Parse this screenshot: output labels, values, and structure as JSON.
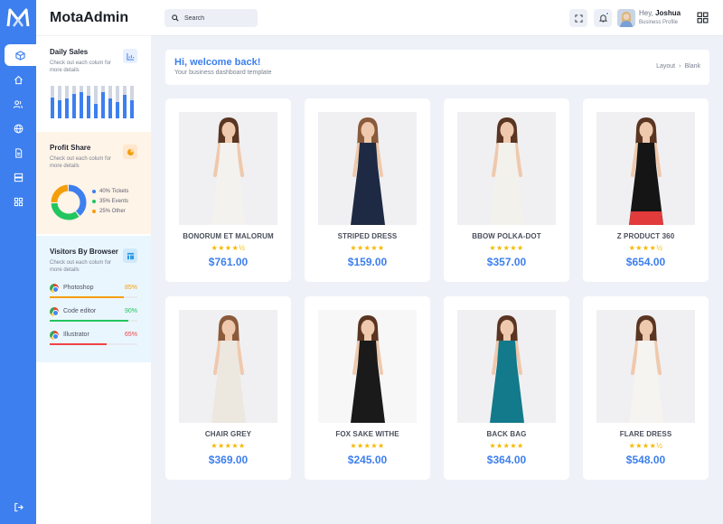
{
  "app": {
    "brand": "MotaAdmin"
  },
  "colors": {
    "accent": "#3d7fee",
    "panel": "#ffffff",
    "background": "#eef1f8",
    "star": "#f5b800"
  },
  "header": {
    "search_placeholder": "Search",
    "greeting_prefix": "Hey,",
    "user_name": "Joshua",
    "user_role": "Business Profile",
    "icons": [
      "search-icon",
      "fullscreen-icon",
      "bell-icon",
      "apps-grid-icon"
    ]
  },
  "sidebar": {
    "items": [
      {
        "icon": "box-icon",
        "active": true
      },
      {
        "icon": "home-icon",
        "active": false
      },
      {
        "icon": "users-icon",
        "active": false
      },
      {
        "icon": "globe-icon",
        "active": false
      },
      {
        "icon": "document-icon",
        "active": false
      },
      {
        "icon": "server-icon",
        "active": false
      },
      {
        "icon": "grid-icon",
        "active": false
      }
    ],
    "logout_icon": "logout-icon"
  },
  "widgets": {
    "daily_sales": {
      "title": "Daily Sales",
      "description": "Check out each colum for more details",
      "icon": "chart-icon",
      "bars": [
        0.65,
        0.55,
        0.6,
        0.75,
        0.8,
        0.7,
        0.45,
        0.8,
        0.6,
        0.5,
        0.72,
        0.55
      ]
    },
    "profit_share": {
      "title": "Profit Share",
      "description": "Check out each colum for more details",
      "icon": "pie-icon",
      "legend": [
        {
          "label": "40% Tickets",
          "color": "#3d7fee",
          "share": 40
        },
        {
          "label": "35% Events",
          "color": "#22c55e",
          "share": 35
        },
        {
          "label": "25% Other",
          "color": "#f59e0b",
          "share": 25
        }
      ]
    },
    "visitors": {
      "title": "Visitors By Browser",
      "description": "Check out each colum for more details",
      "icon": "layout-icon",
      "browsers": [
        {
          "name": "Photoshop",
          "percent": "85%",
          "value": 0.85,
          "color": "#f59e0b"
        },
        {
          "name": "Code editor",
          "percent": "90%",
          "value": 0.9,
          "color": "#22c55e"
        },
        {
          "name": "Illustrator",
          "percent": "65%",
          "value": 0.65,
          "color": "#ef4444"
        }
      ]
    }
  },
  "welcome": {
    "title": "Hi, welcome back!",
    "subtitle": "Your business dashboard template",
    "breadcrumb": [
      "Layout",
      "Blank"
    ]
  },
  "products": [
    {
      "name": "BONORUM ET MALORUM",
      "price": "$761.00",
      "rating": 4.5,
      "stars": "★★★★½",
      "dress": "#f4f2ee",
      "trim": "#f4f2ee"
    },
    {
      "name": "STRIPED DRESS",
      "price": "$159.00",
      "rating": 5,
      "stars": "★★★★★",
      "dress": "#1e2a44",
      "trim": "#1e2a44"
    },
    {
      "name": "BBOW POLKA-DOT",
      "price": "$357.00",
      "rating": 5,
      "stars": "★★★★★",
      "dress": "#f3f1ec",
      "trim": "#f3f1ec"
    },
    {
      "name": "Z PRODUCT 360",
      "price": "$654.00",
      "rating": 4.5,
      "stars": "★★★★½",
      "dress": "#151515",
      "trim": "#e23b3b"
    },
    {
      "name": "CHAIR GREY",
      "price": "$369.00",
      "rating": 5,
      "stars": "★★★★★",
      "dress": "#ece7df",
      "trim": "#ece7df"
    },
    {
      "name": "FOX SAKE WITHE",
      "price": "$245.00",
      "rating": 5,
      "stars": "★★★★★",
      "dress": "#1a1a1a",
      "trim": "#1a1a1a"
    },
    {
      "name": "BACK BAG",
      "price": "$364.00",
      "rating": 5,
      "stars": "★★★★★",
      "dress": "#127a8a",
      "trim": "#127a8a"
    },
    {
      "name": "FLARE DRESS",
      "price": "$548.00",
      "rating": 4.5,
      "stars": "★★★★½",
      "dress": "#f6f4f0",
      "trim": "#f6f4f0"
    }
  ]
}
